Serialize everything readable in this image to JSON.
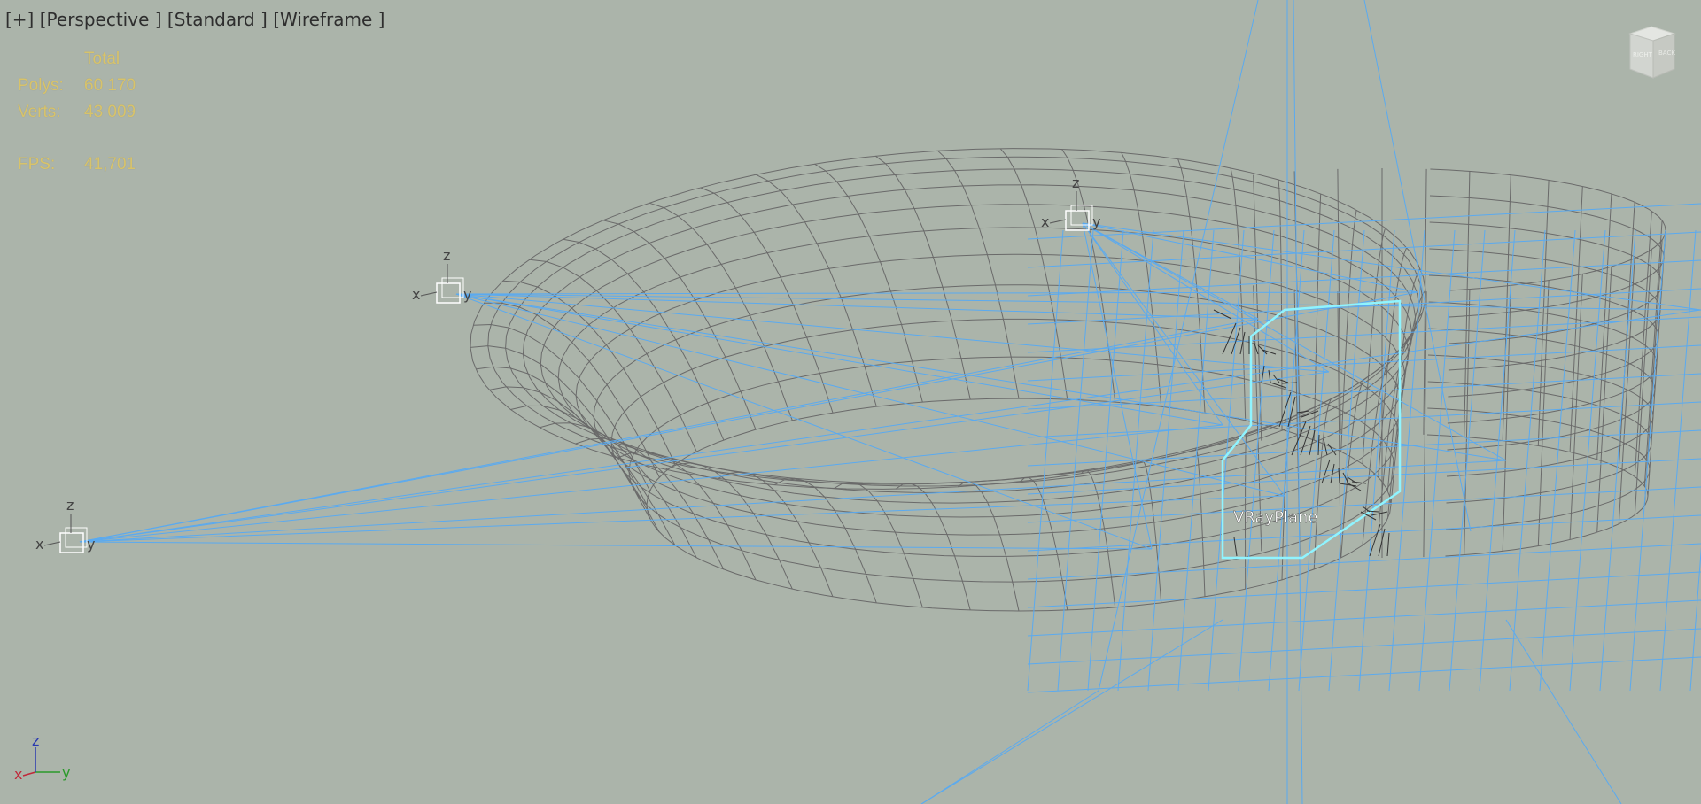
{
  "viewport": {
    "labels": [
      "[+]",
      "[Perspective ]",
      "[Standard ]",
      "[Wireframe ]"
    ],
    "stats": {
      "header": "Total",
      "polys_label": "Polys:",
      "polys_value": "60 170",
      "verts_label": "Verts:",
      "verts_value": "43 009",
      "fps_label": "FPS:",
      "fps_value": "41,701"
    },
    "viewcube": {
      "front_label": "RIGHT",
      "side_label": "BACK"
    },
    "object_label": "VRayPlane",
    "axis_letters": {
      "x": "x",
      "y": "y",
      "z": "z"
    },
    "colors": {
      "background": "#abb4aa",
      "wire_gray": "#6a6a6a",
      "wire_blue": "#5aaaf0",
      "selection_cyan": "#8ff4ff",
      "stats_text": "#d8c36a",
      "axis_x": "#c0283a",
      "axis_y": "#2a9a2a",
      "axis_z": "#2a3ab0"
    }
  }
}
